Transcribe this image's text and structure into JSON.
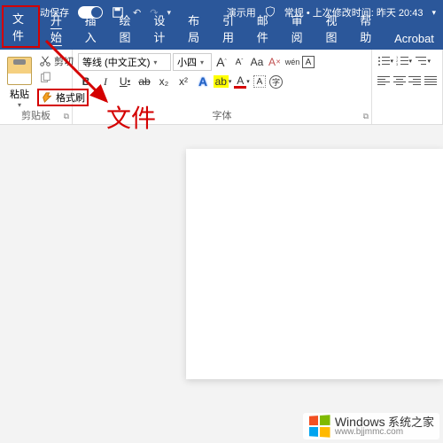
{
  "titleBar": {
    "autosave": "自动保存",
    "status": "演示用",
    "security": "常规 • 上次修改时间: 昨天 20:43"
  },
  "tabs": {
    "file": "文件",
    "home": "开始",
    "insert": "插入",
    "draw": "绘图",
    "design": "设计",
    "layout": "布局",
    "references": "引用",
    "mailings": "邮件",
    "review": "审阅",
    "view": "视图",
    "help": "帮助",
    "acrobat": "Acrobat"
  },
  "clipboard": {
    "cut": "剪切",
    "paste": "粘贴",
    "formatPainter": "格式刷",
    "groupLabel": "剪贴板"
  },
  "font": {
    "family": "等线 (中文正文)",
    "size": "小四",
    "groupLabel": "字体",
    "bold": "B",
    "italic": "I",
    "underline": "U",
    "strike": "ab",
    "sub": "x₂",
    "sup": "x²",
    "clearA": "A",
    "styleA": "A",
    "wen": "wén",
    "bigA": "A",
    "charBg": "A",
    "fontColor": "A",
    "circledChar": "字",
    "bigA2": "A",
    "bigA3": "A",
    "Aa": "Aa",
    "clear": "Aᵩ"
  },
  "annotation": {
    "text": "文件"
  },
  "watermark": {
    "brand": "Windows",
    "site": "系统之家",
    "url": "www.bjjmmc.com"
  }
}
